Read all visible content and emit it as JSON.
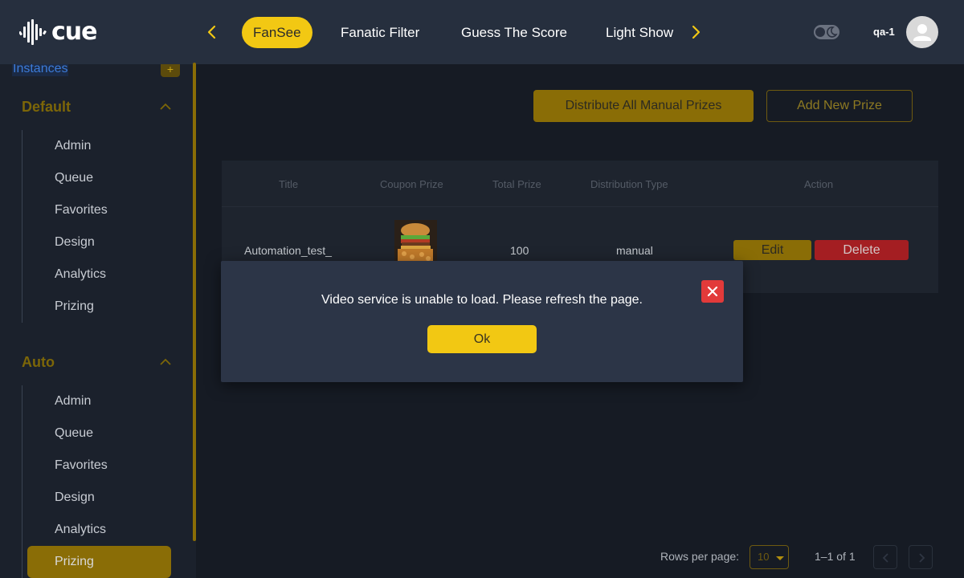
{
  "brand": {
    "name": "cue"
  },
  "header": {
    "tabs": [
      {
        "label": "FanSee",
        "active": true
      },
      {
        "label": "Fanatic Filter",
        "active": false
      },
      {
        "label": "Guess The Score",
        "active": false
      },
      {
        "label": "Light Show",
        "active": false
      }
    ],
    "username": "qa-1",
    "icons": {
      "prev": "chevron-left-icon",
      "next": "chevron-right-icon",
      "theme": "moon-icon",
      "avatar": "user-icon"
    }
  },
  "sidebar": {
    "instances_label": "Instances",
    "add_label": "+",
    "groups": [
      {
        "title": "Default",
        "items": [
          "Admin",
          "Queue",
          "Favorites",
          "Design",
          "Analytics",
          "Prizing"
        ]
      },
      {
        "title": "Auto",
        "items": [
          "Admin",
          "Queue",
          "Favorites",
          "Design",
          "Analytics",
          "Prizing"
        ],
        "active_item": "Prizing"
      }
    ]
  },
  "actions": {
    "distribute_label": "Distribute All Manual Prizes",
    "add_prize_label": "Add New Prize"
  },
  "table": {
    "columns": [
      "Title",
      "Coupon Prize",
      "Total Prize",
      "Distribution Type",
      "Action"
    ],
    "rows": [
      {
        "title": "Automation_test_",
        "coupon_prize": "burger-image",
        "total_prize": "100",
        "distribution_type": "manual",
        "edit_label": "Edit",
        "delete_label": "Delete"
      }
    ]
  },
  "pagination": {
    "rows_per_page_label": "Rows per page:",
    "rows_per_page_value": "10",
    "range_text": "1–1 of 1"
  },
  "modal": {
    "message": "Video service is unable to load. Please refresh the page.",
    "ok_label": "Ok"
  },
  "colors": {
    "accent": "#f2c813",
    "danger": "#e23a3a",
    "header_bg": "#262f3e",
    "modal_bg": "#2c3547"
  }
}
